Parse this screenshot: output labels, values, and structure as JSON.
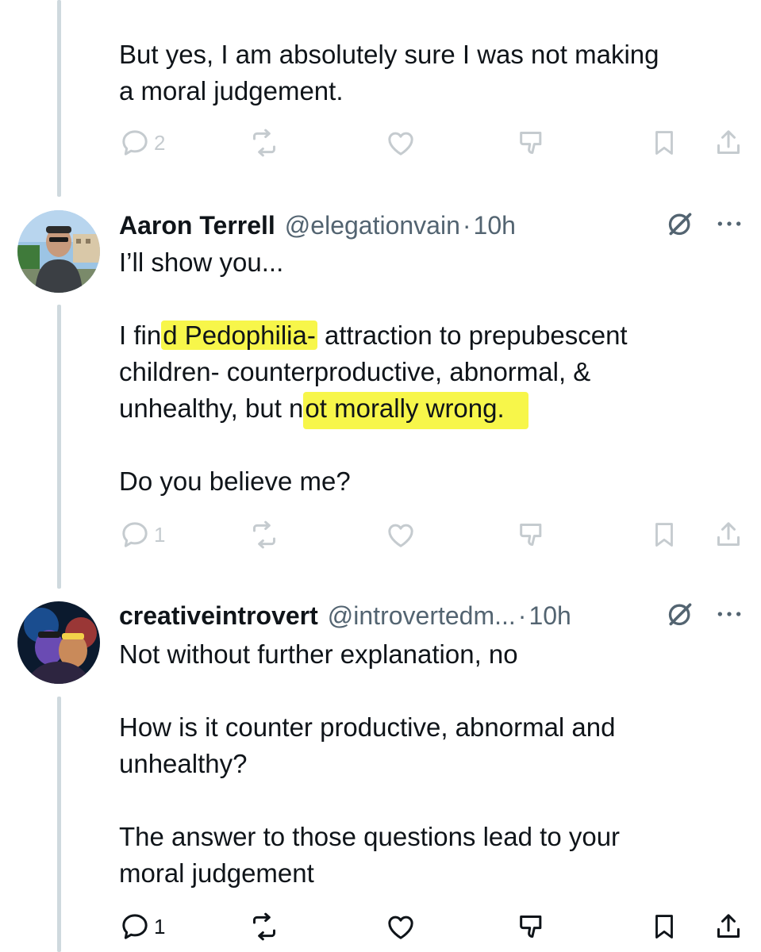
{
  "thread": {
    "top_post": {
      "lines": [
        "But yes, I am absolutely sure I was not making",
        "a moral judgement."
      ],
      "reply_count": "2"
    },
    "post2": {
      "display_name": "Aaron Terrell",
      "handle": "@elegationvain",
      "separator": "·",
      "time": "10h",
      "intro": "I’ll show you...",
      "para_pre": "I fin",
      "para_hl1": "d Pedophilia-",
      "para_mid1": " attraction to prepubescent",
      "para_line2": "children- counterproductive, abnormal, &",
      "para_line3_pre": "unhealthy, but n",
      "para_hl2": "ot morally wrong.",
      "question": "Do you believe me?",
      "reply_count": "1"
    },
    "post3": {
      "display_name": "creativeintrovert",
      "handle": "@introvertedm...",
      "separator": "·",
      "time": "10h",
      "line1": "Not without further explanation, no",
      "para2_l1": "How is it counter productive, abnormal and",
      "para2_l2": "unhealthy?",
      "para3_l1": "The answer to those questions lead to your",
      "para3_l2": "moral judgement",
      "reply_count": "1"
    }
  },
  "icons": [
    "reply-icon",
    "repost-icon",
    "like-icon",
    "dislike-icon",
    "bookmark-icon",
    "share-icon",
    "grok-icon",
    "more-icon"
  ],
  "colors": {
    "text": "#0f1419",
    "secondary": "#536471",
    "highlight": "#f7f64a",
    "thread_line": "#cfd9de"
  }
}
